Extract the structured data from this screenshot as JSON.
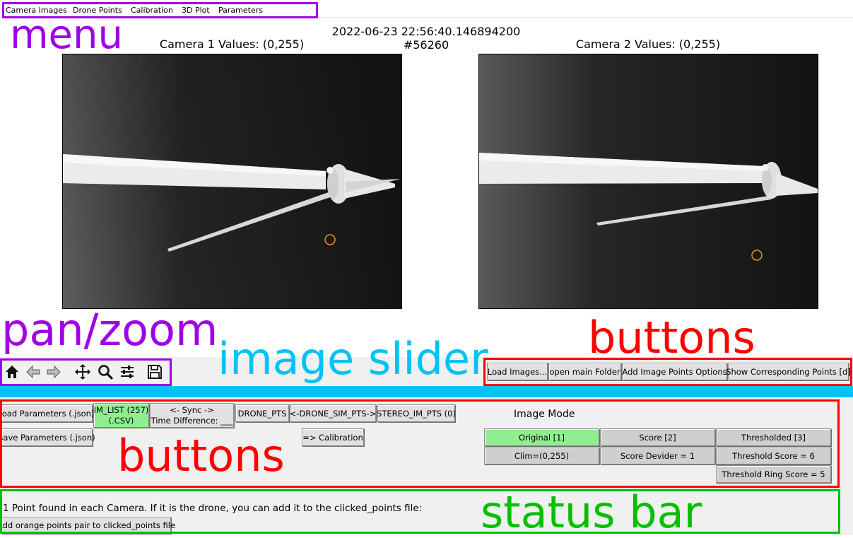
{
  "menu": {
    "items": [
      "Camera Images",
      "Drone Points",
      "Calibration",
      "3D Plot",
      "Parameters"
    ]
  },
  "plot": {
    "timestamp": "2022-06-23 22:56:40.146894200",
    "frame_id": "#56260",
    "cam1_title": "Camera 1 Values: (0,255)",
    "cam2_title": "Camera 2 Values: (0,255)"
  },
  "toolbar": {
    "icons": [
      "home-icon",
      "back-arrow-icon",
      "forward-arrow-icon",
      "pan-move-icon",
      "zoom-magnifier-icon",
      "configure-subplots-icon",
      "save-figure-icon"
    ]
  },
  "top_buttons": [
    "Load Images...",
    "open main Folder",
    "Add Image Points Options",
    "Show Corresponding Points [d]"
  ],
  "panel": {
    "load_params": "load Parameters (.json)",
    "save_params": "save Parameters (.json)",
    "im_list_1": "IM_LIST (257)",
    "im_list_2": "(.CSV)",
    "sync_1": "<- Sync ->",
    "sync_2": "Time Difference: ___",
    "drone_pts": "DRONE_PTS",
    "drone_sim_pts": "<-DRONE_SIM_PTS->",
    "stereo_im_pts": "STEREO_IM_PTS (0)",
    "to_calibration": "=> Calibration",
    "image_mode_label": "Image Mode",
    "original": "Original [1]",
    "score": "Score [2]",
    "thresholded": "Thresholded [3]",
    "clim": "Clim=(0,255)",
    "score_devider": "Score Devider = 1",
    "threshold_score": "Threshold Score = 6",
    "threshold_ring_score": "Threshold Ring Score = 5"
  },
  "status": {
    "message": "1 Point found in each Camera. If it is the drone, you can add it to the clicked_points file:",
    "add_button": "Add orange points pair to clicked_points file"
  },
  "annotations": {
    "menu": "menu",
    "pan_zoom": "pan/zoom",
    "image_slider": "image slider",
    "buttons_top": "buttons",
    "buttons_bottom": "buttons",
    "status_bar": "status bar"
  },
  "colors": {
    "annotation_purple": "#a000e6",
    "annotation_red": "#ff0000",
    "annotation_cyan": "#00c3f4",
    "annotation_green": "#00c000",
    "button_active_green": "#90ee90",
    "marker_orange": "#e8901a"
  }
}
